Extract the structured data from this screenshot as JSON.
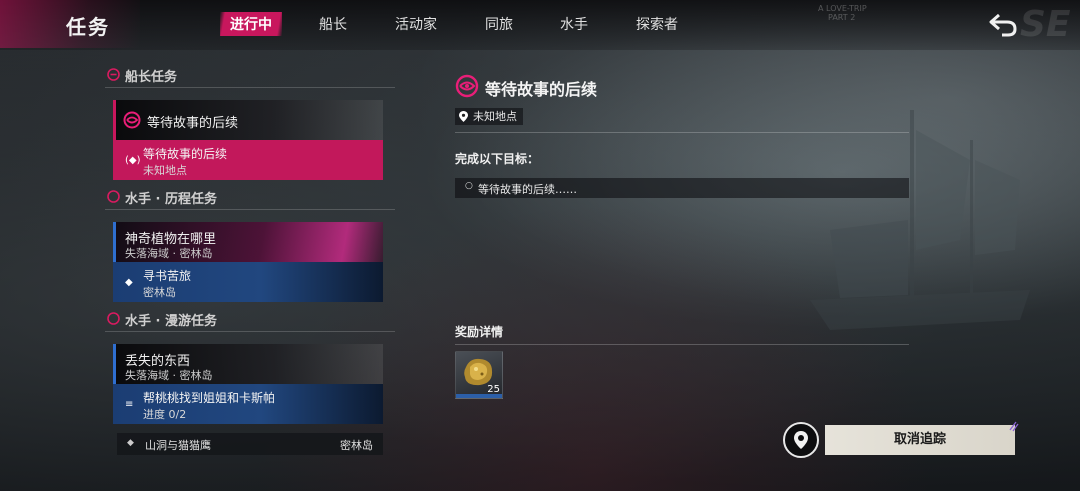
{
  "app": {
    "title": "任务"
  },
  "tabs": [
    {
      "label": "进行中",
      "active": true
    },
    {
      "label": "船长"
    },
    {
      "label": "活动家"
    },
    {
      "label": "同旅"
    },
    {
      "label": "水手"
    },
    {
      "label": "探索者"
    }
  ],
  "watermark": {
    "line1": "A LOVE-TRIP",
    "line2": "PART 2",
    "big": "SE"
  },
  "sections": {
    "captain": {
      "header": "船长任务",
      "quest": {
        "title": "等待故事的后续"
      },
      "step": {
        "title": "等待故事的后续",
        "location": "未知地点"
      }
    },
    "sailor_history": {
      "header": "水手 · 历程任务",
      "quest": {
        "title": "神奇植物在哪里",
        "location": "失落海域 · 密林岛"
      },
      "step": {
        "title": "寻书苦旅",
        "location": "密林岛"
      }
    },
    "sailor_roam": {
      "header": "水手 · 漫游任务",
      "quest": {
        "title": "丢失的东西",
        "location": "失落海域 · 密林岛"
      },
      "step": {
        "title": "帮桃桃找到姐姐和卡斯帕",
        "progress": "进度 0/2"
      },
      "extra": {
        "title": "山洞与猫猫鹰",
        "location": "密林岛"
      }
    }
  },
  "detail": {
    "title": "等待故事的后续",
    "location": "未知地点",
    "objectives_header": "完成以下目标：",
    "objectives": [
      "等待故事的后续……"
    ],
    "rewards_header": "奖励详情",
    "rewards": [
      {
        "name": "gold-nugget-icon",
        "count": "25"
      }
    ]
  },
  "actions": {
    "untrack_label": "取消追踪"
  },
  "colors": {
    "accent": "#c8175d",
    "blue": "#21477f"
  }
}
